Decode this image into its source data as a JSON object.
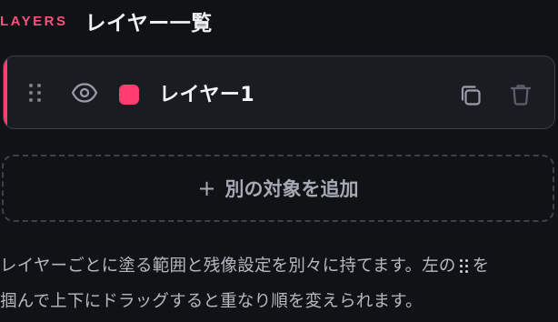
{
  "header": {
    "eyebrow": "LAYERS",
    "title": "レイヤー一覧"
  },
  "layers": [
    {
      "name": "レイヤー1",
      "color": "#ff3d6f",
      "visible": true
    }
  ],
  "add_button": {
    "icon": "+",
    "label": "別の対象を追加"
  },
  "help": {
    "part1": "レイヤーごとに塗る範囲と残像設定を別々に持てます。左の",
    "part2": "を",
    "line2": "掴んで上下にドラッグすると重なり順を変えられます。"
  },
  "icons": {
    "drag": "drag-handle-icon",
    "visibility": "eye-icon",
    "duplicate": "copy-icon",
    "delete": "trash-icon"
  },
  "colors": {
    "accent": "#ff3d6f",
    "background": "#111216",
    "card": "#1a1c21"
  }
}
